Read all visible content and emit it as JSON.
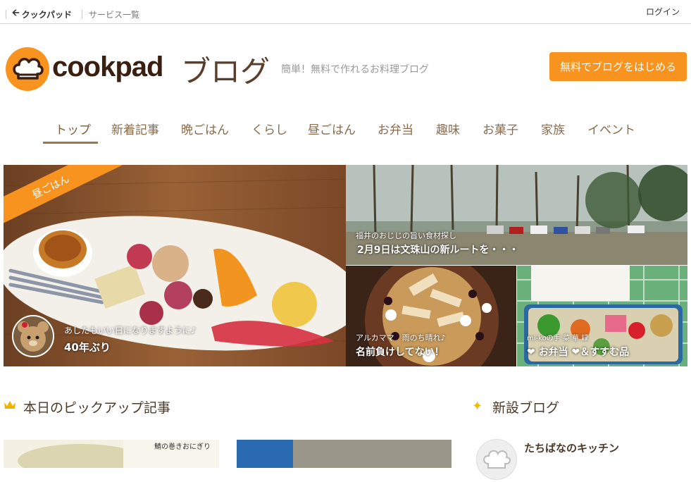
{
  "topbar": {
    "cookpad_link": "クックパッド",
    "services_link": "サービス一覧",
    "login": "ログイン"
  },
  "header": {
    "logo_text": "cookpad",
    "blog_text": "ブログ",
    "tagline": "簡単！無料で作れるお料理ブログ",
    "start_button": "無料でブログをはじめる"
  },
  "nav": {
    "items": [
      {
        "label": "トップ"
      },
      {
        "label": "新着記事"
      },
      {
        "label": "晩ごはん"
      },
      {
        "label": "くらし"
      },
      {
        "label": "昼ごはん"
      },
      {
        "label": "お弁当"
      },
      {
        "label": "趣味"
      },
      {
        "label": "お菓子"
      },
      {
        "label": "家族"
      },
      {
        "label": "イベント"
      }
    ]
  },
  "hero": {
    "main": {
      "ribbon": "昼ごはん",
      "blog_name": "あしたもいい日になりますように♪",
      "title": "40年ぶり"
    },
    "top_right": {
      "blog_name": "福井のおじじの旨い食材探し",
      "title": "2月9日は文珠山の新ルートを・・・"
    },
    "bottom_left": {
      "blog_name": "アルカママ　雨のち晴れ♪",
      "title": "名前負けしてない！"
    },
    "bottom_right": {
      "blog_name": "mi-koの手 菜 華 録",
      "title": "❤ お弁当 ❤＆すすむ品"
    }
  },
  "sections": {
    "pickup_title": "本日のピックアップ記事",
    "new_blogs_title": "新設ブログ",
    "new_blog_name": "たちばなのキッチン",
    "thumb1_note": "鯖の巻きおにぎり"
  },
  "colors": {
    "accent": "#f7931e",
    "brown_text": "#8a6b4c",
    "nav_underline": "#9a7550"
  }
}
